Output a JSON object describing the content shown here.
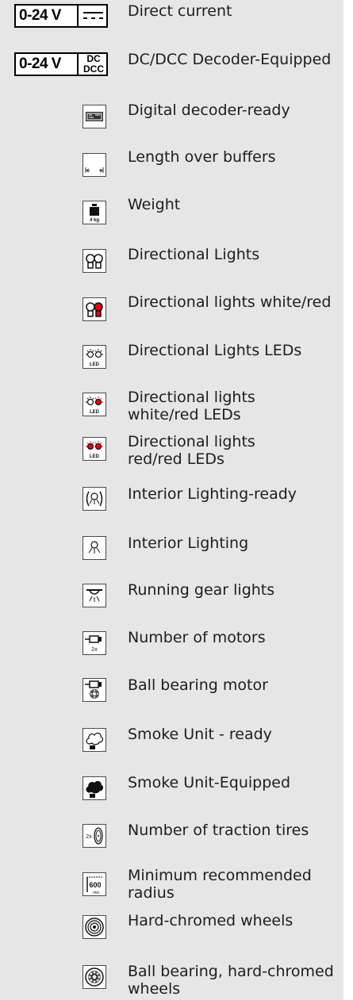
{
  "voltage_badges": [
    {
      "text": "0-24 V",
      "symbol": "dc-symbol-icon"
    },
    {
      "text": "0-24 V",
      "symbol_lines": [
        "DC",
        "DCC"
      ]
    }
  ],
  "items": [
    {
      "label": "Direct current",
      "icon": "direct-current-icon"
    },
    {
      "label": "DC/DCC Decoder-Equipped",
      "icon": "dc-dcc-icon"
    },
    {
      "label": "Digital decoder-ready",
      "icon": "decoder-ready-icon"
    },
    {
      "label": "Length over buffers",
      "icon": "length-over-buffers-icon"
    },
    {
      "label": "Weight",
      "icon": "weight-icon",
      "icon_text": "4 kg"
    },
    {
      "label": "Directional Lights",
      "icon": "directional-lights-icon"
    },
    {
      "label": "Directional lights white/red",
      "icon": "directional-lights-white-red-icon"
    },
    {
      "label": "Directional Lights LEDs",
      "icon": "directional-lights-leds-icon",
      "icon_text": "LED"
    },
    {
      "label_lines": [
        "Directional lights",
        "white/red LEDs"
      ],
      "icon": "directional-lights-white-red-leds-icon",
      "icon_text": "LED"
    },
    {
      "label_lines": [
        "Directional lights",
        "red/red LEDs"
      ],
      "icon": "directional-lights-red-red-leds-icon",
      "icon_text": "LED"
    },
    {
      "label": "Interior Lighting-ready",
      "icon": "interior-lighting-ready-icon"
    },
    {
      "label": "Interior Lighting",
      "icon": "interior-lighting-icon"
    },
    {
      "label": "Running gear lights",
      "icon": "running-gear-lights-icon"
    },
    {
      "label": "Number of motors",
      "icon": "number-of-motors-icon",
      "icon_text": "2x"
    },
    {
      "label": "Ball bearing motor",
      "icon": "ball-bearing-motor-icon"
    },
    {
      "label": "Smoke Unit - ready",
      "icon": "smoke-unit-ready-icon"
    },
    {
      "label": "Smoke Unit-Equipped",
      "icon": "smoke-unit-equipped-icon"
    },
    {
      "label": "Number of traction tires",
      "icon": "traction-tires-icon",
      "icon_text": "2x"
    },
    {
      "label_lines": [
        "Minimum recommended",
        "radius"
      ],
      "icon": "minimum-radius-icon",
      "icon_text": "600",
      "icon_subtext": "min."
    },
    {
      "label": "Hard-chromed wheels",
      "icon": "hard-chromed-wheels-icon"
    },
    {
      "label_lines": [
        "Ball bearing, hard-chromed",
        "wheels"
      ],
      "icon": "ball-bearing-chromed-wheels-icon"
    }
  ],
  "colors": {
    "panel": "#e6e6e6",
    "text": "#1d1d1d",
    "red": "#e2001a"
  }
}
